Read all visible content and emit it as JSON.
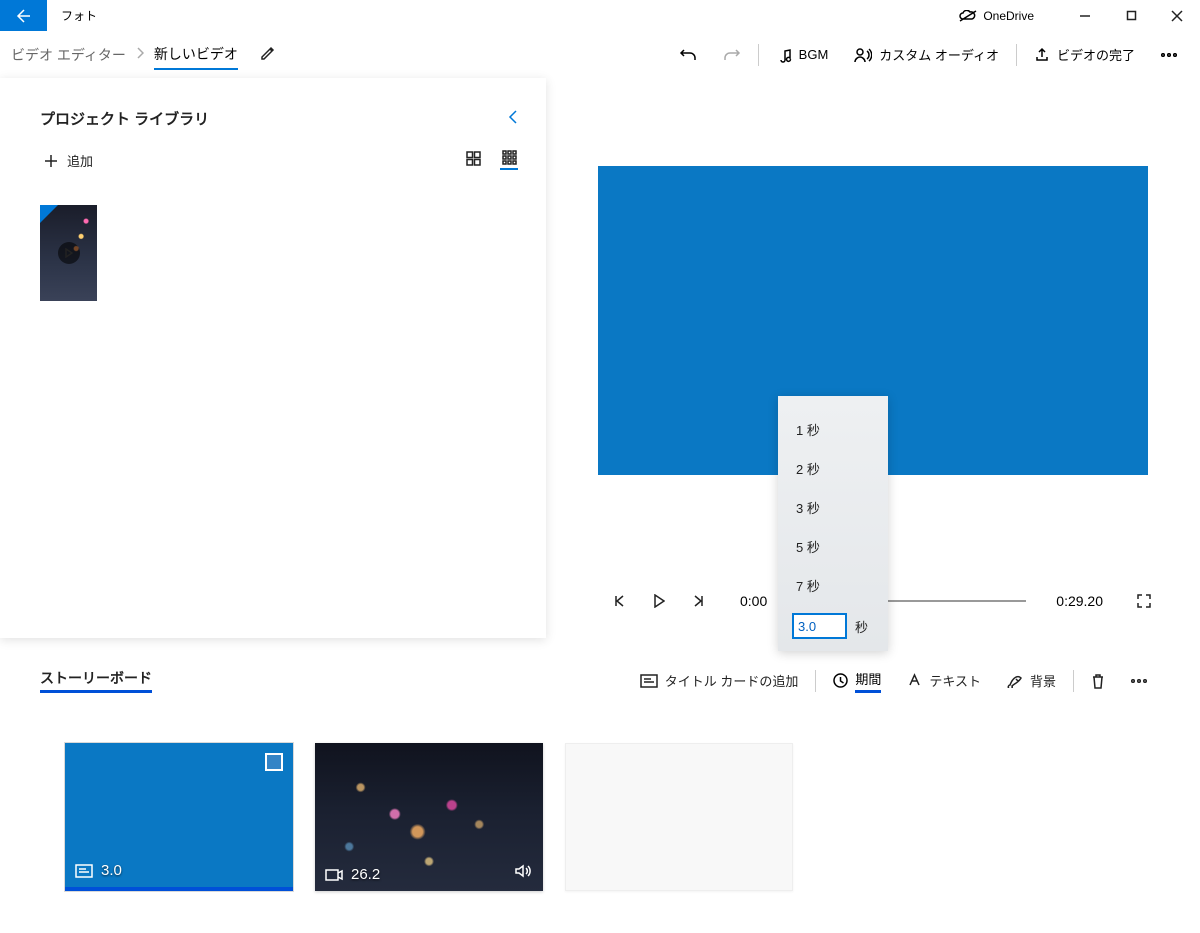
{
  "titlebar": {
    "app_name": "フォト",
    "onedrive": "OneDrive"
  },
  "breadcrumb": {
    "root": "ビデオ エディター",
    "project": "新しいビデオ"
  },
  "toolbar": {
    "bgm": "BGM",
    "custom_audio": "カスタム オーディオ",
    "finish": "ビデオの完了"
  },
  "library": {
    "title": "プロジェクト ライブラリ",
    "add": "追加"
  },
  "player": {
    "t_start": "0:00",
    "t_end": "0:29.20"
  },
  "duration_popup": {
    "options": [
      "1 秒",
      "2 秒",
      "3 秒",
      "5 秒",
      "7 秒"
    ],
    "value": "3.0",
    "unit": "秒"
  },
  "storyboard": {
    "title": "ストーリーボード",
    "add_title_card": "タイトル カードの追加",
    "duration": "期間",
    "text": "テキスト",
    "background": "背景"
  },
  "clips": [
    {
      "type": "title",
      "duration": "3.0"
    },
    {
      "type": "video",
      "duration": "26.2"
    }
  ]
}
